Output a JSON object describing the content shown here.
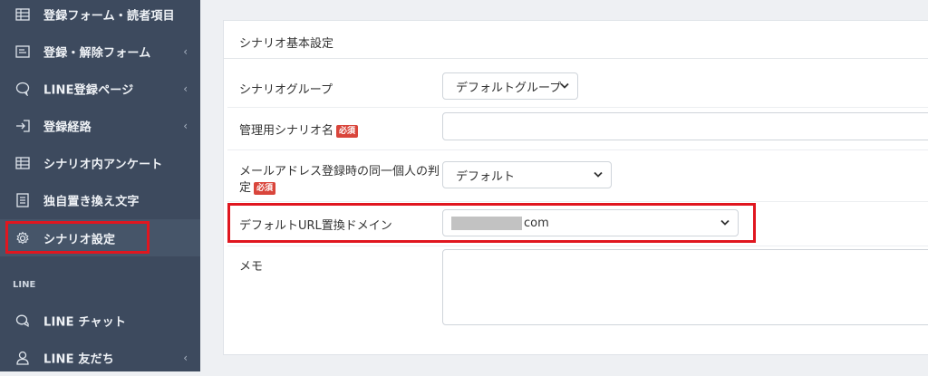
{
  "sidebar": {
    "items": [
      {
        "label": "登録フォーム・読者項目",
        "icon": "table-icon",
        "chevron": false
      },
      {
        "label": "登録・解除フォーム",
        "icon": "form-icon",
        "chevron": true
      },
      {
        "label": "LINE登録ページ",
        "icon": "speech-bubble-icon",
        "chevron": true
      },
      {
        "label": "登録経路",
        "icon": "sign-in-icon",
        "chevron": true
      },
      {
        "label": "シナリオ内アンケート",
        "icon": "table-icon",
        "chevron": false
      },
      {
        "label": "独自置き換え文字",
        "icon": "document-icon",
        "chevron": false
      },
      {
        "label": "シナリオ設定",
        "icon": "gear-icon",
        "chevron": false,
        "active": true
      },
      {
        "label": "LINE チャット",
        "icon": "chat-icon",
        "chevron": false
      },
      {
        "label": "LINE 友だち",
        "icon": "user-icon",
        "chevron": true
      }
    ],
    "section_label": "LINE",
    "chevron_glyph": "‹"
  },
  "card": {
    "title": "シナリオ基本設定",
    "rows": {
      "group_label": "シナリオグループ",
      "group_value": "デフォルトグループ",
      "name_label": "管理用シナリオ名",
      "required_badge": "必須",
      "judge_label_line1": "メールアドレス登録時の同一個人の判",
      "judge_label_line2": "定",
      "judge_value": "デフォルト",
      "domain_label": "デフォルトURL置換ドメイン",
      "domain_value_suffix": "com",
      "memo_label": "メモ"
    }
  },
  "colors": {
    "sidebar_bg": "#3d4a5e",
    "highlight": "#e0161f",
    "badge": "#d9453b"
  }
}
